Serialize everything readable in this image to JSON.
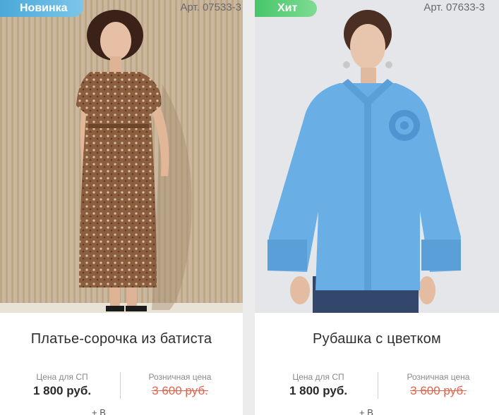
{
  "products": [
    {
      "badge": "Новинка",
      "article": "Арт. 07533-3",
      "title": "Платье-сорочка из батиста",
      "sp_label": "Цена для СП",
      "sp_price": "1 800 руб.",
      "retail_label": "Розничная цена",
      "retail_price": "3 600 руб.",
      "more": "+ В",
      "image": "brown-print-shirt-dress-photo"
    },
    {
      "badge": "Хит",
      "article": "Арт. 07633-3",
      "title": "Рубашка с цветком",
      "sp_label": "Цена для СП",
      "sp_price": "1 800 руб.",
      "retail_label": "Розничная цена",
      "retail_price": "3 600 руб.",
      "more": "+ В",
      "image": "blue-shirt-with-flower-photo"
    }
  ],
  "colors": {
    "badge_new": "#5ab3de",
    "badge_hit": "#55cc75",
    "old_price": "#e0654f"
  }
}
